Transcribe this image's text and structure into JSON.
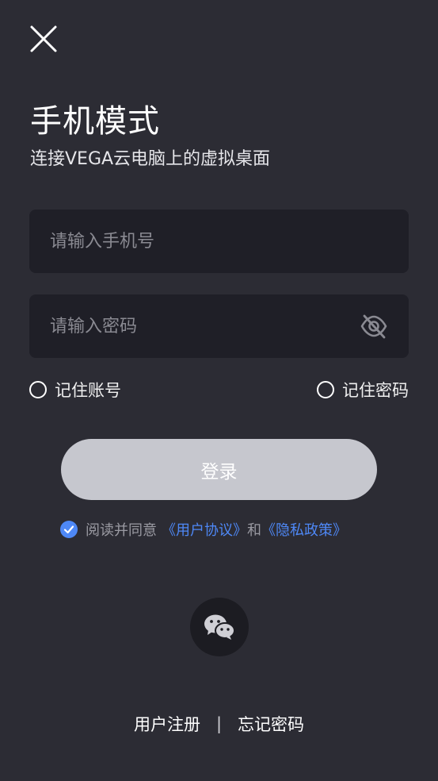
{
  "header": {
    "title": "手机模式",
    "subtitle": "连接VEGA云电脑上的虚拟桌面",
    "close_icon": "close-icon"
  },
  "form": {
    "phone_placeholder": "请输入手机号",
    "phone_value": "",
    "password_placeholder": "请输入密码",
    "password_value": "",
    "eye_icon": "eye-off-icon",
    "remember_account_label": "记住账号",
    "remember_account_checked": false,
    "remember_password_label": "记住密码",
    "remember_password_checked": false
  },
  "login_button_label": "登录",
  "agreement": {
    "checked": true,
    "prefix": "阅读并同意",
    "user_agreement": "《用户协议》",
    "joiner": "和",
    "privacy_policy": "《隐私政策》"
  },
  "social": {
    "wechat_icon": "wechat-icon"
  },
  "footer": {
    "register_label": "用户注册",
    "separator": "|",
    "forgot_password_label": "忘记密码"
  },
  "colors": {
    "background": "#2c2c34",
    "field_background": "#1f1f27",
    "accent": "#4e88f6",
    "login_button": "#c6c7ce"
  }
}
